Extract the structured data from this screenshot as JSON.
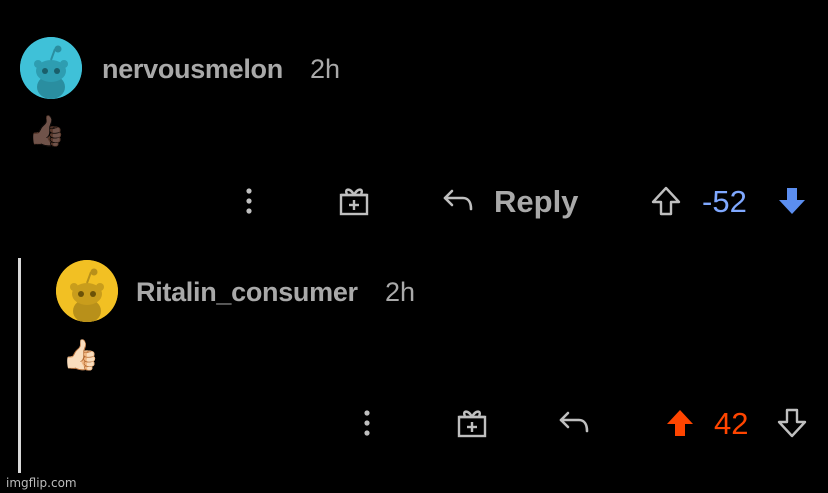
{
  "comments": [
    {
      "username": "nervousmelon",
      "age": "2h",
      "emoji": "👍🏿",
      "avatar_color": "#3fc1d8",
      "reply_label": "Reply",
      "score": "-52",
      "vote_state": "downvoted",
      "score_color": "#7fa8ff"
    },
    {
      "username": "Ritalin_consumer",
      "age": "2h",
      "emoji": "👍🏻",
      "avatar_color": "#f2c023",
      "score": "42",
      "vote_state": "upvoted",
      "score_color": "#ff4500"
    }
  ],
  "watermark": "imgflip.com",
  "icons": {
    "more": "more-options-icon",
    "award": "gift-icon",
    "reply": "reply-arrow-icon",
    "upvote": "upvote-arrow-icon",
    "downvote": "downvote-arrow-icon"
  }
}
